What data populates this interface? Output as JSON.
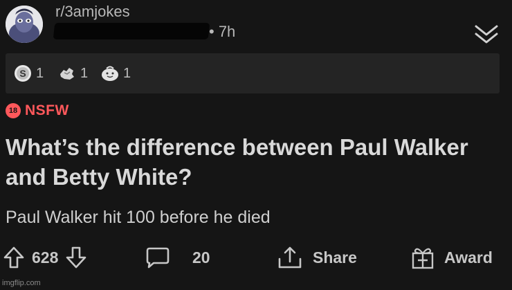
{
  "post": {
    "subreddit": "r/3amjokes",
    "age": "• 7h",
    "nsfw_badge": "18",
    "nsfw_label": "NSFW",
    "title": "What’s the difference between Paul Walker and Betty White?",
    "body": "Paul Walker hit 100 before he died"
  },
  "awards": [
    {
      "icon": "silver-award-icon",
      "count": "1"
    },
    {
      "icon": "helpful-award-icon",
      "count": "1"
    },
    {
      "icon": "wholesome-award-icon",
      "count": "1"
    }
  ],
  "actions": {
    "upvotes": "628",
    "comments": "20",
    "share_label": "Share",
    "award_label": "Award"
  },
  "watermark": "imgflip.com",
  "colors": {
    "background": "#151515",
    "awards_bar": "#242424",
    "nsfw": "#ff585b",
    "text": "#d9d9d9",
    "muted": "#b8b8b8"
  }
}
